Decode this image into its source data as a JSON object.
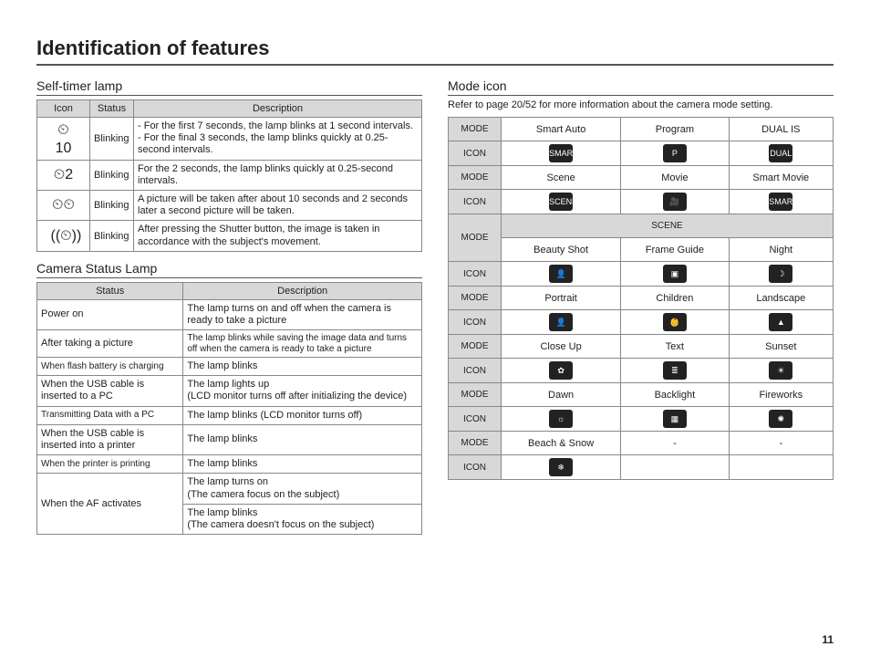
{
  "page_title": "Identification of features",
  "page_number": "11",
  "self_timer": {
    "heading": "Self-timer lamp",
    "headers": {
      "icon": "Icon",
      "status": "Status",
      "description": "Description"
    },
    "rows": [
      {
        "icon": "⏲10",
        "status": "Blinking",
        "description": "- For the first 7 seconds, the lamp blinks at 1 second intervals.\n- For the final 3 seconds, the lamp blinks quickly at 0.25-second intervals."
      },
      {
        "icon": "⏲2",
        "status": "Blinking",
        "description": "For the 2 seconds, the lamp blinks quickly at 0.25-second intervals."
      },
      {
        "icon": "⏲⏲",
        "status": "Blinking",
        "description": "A picture will be taken after about 10 seconds and 2 seconds later a second picture will be taken."
      },
      {
        "icon": "((⏲))",
        "status": "Blinking",
        "description": "After pressing the Shutter button, the image is taken in accordance with the subject's movement."
      }
    ]
  },
  "camera_status": {
    "heading": "Camera Status Lamp",
    "headers": {
      "status": "Status",
      "description": "Description"
    },
    "rows": [
      {
        "status": "Power on",
        "description": "The lamp turns on and off when the camera is ready to take a picture"
      },
      {
        "status": "After taking a picture",
        "description": "The lamp blinks while saving the image data and turns off when the camera is ready to take a picture"
      },
      {
        "status": "When flash battery is charging",
        "description": "The lamp blinks"
      },
      {
        "status": "When the USB cable is inserted to a PC",
        "description": "The lamp lights up\n(LCD monitor turns off after initializing the device)"
      },
      {
        "status": "Transmitting Data with a PC",
        "description": "The lamp blinks (LCD monitor turns off)"
      },
      {
        "status": "When the USB cable is inserted into a printer",
        "description": "The lamp blinks"
      },
      {
        "status": "When the printer is printing",
        "description": "The lamp blinks"
      }
    ],
    "af_row": {
      "status": "When the AF activates",
      "desc1": "The lamp turns on\n(The camera focus on the subject)",
      "desc2": "The lamp blinks\n(The camera doesn't focus on the subject)"
    }
  },
  "mode_icon": {
    "heading": "Mode icon",
    "note": "Refer to page 20/52 for more information about the camera mode setting.",
    "labels": {
      "mode": "MODE",
      "icon": "ICON",
      "scene": "SCENE"
    },
    "group1": {
      "modes": [
        "Smart Auto",
        "Program",
        "DUAL IS"
      ],
      "icons": [
        "SMART",
        "P",
        "DUAL"
      ]
    },
    "group2": {
      "modes": [
        "Scene",
        "Movie",
        "Smart Movie"
      ],
      "icons": [
        "SCENE",
        "🎥",
        "SMART"
      ]
    },
    "scene_rows": [
      {
        "modes": [
          "Beauty Shot",
          "Frame Guide",
          "Night"
        ],
        "icons": [
          "👤",
          "▣",
          "☽"
        ]
      },
      {
        "modes": [
          "Portrait",
          "Children",
          "Landscape"
        ],
        "icons": [
          "👤",
          "👶",
          "▲"
        ]
      },
      {
        "modes": [
          "Close Up",
          "Text",
          "Sunset"
        ],
        "icons": [
          "✿",
          "≣",
          "☀"
        ]
      },
      {
        "modes": [
          "Dawn",
          "Backlight",
          "Fireworks"
        ],
        "icons": [
          "☼",
          "▦",
          "✺"
        ]
      },
      {
        "modes": [
          "Beach & Snow",
          "-",
          "-"
        ],
        "icons": [
          "❄",
          "",
          ""
        ]
      }
    ]
  }
}
